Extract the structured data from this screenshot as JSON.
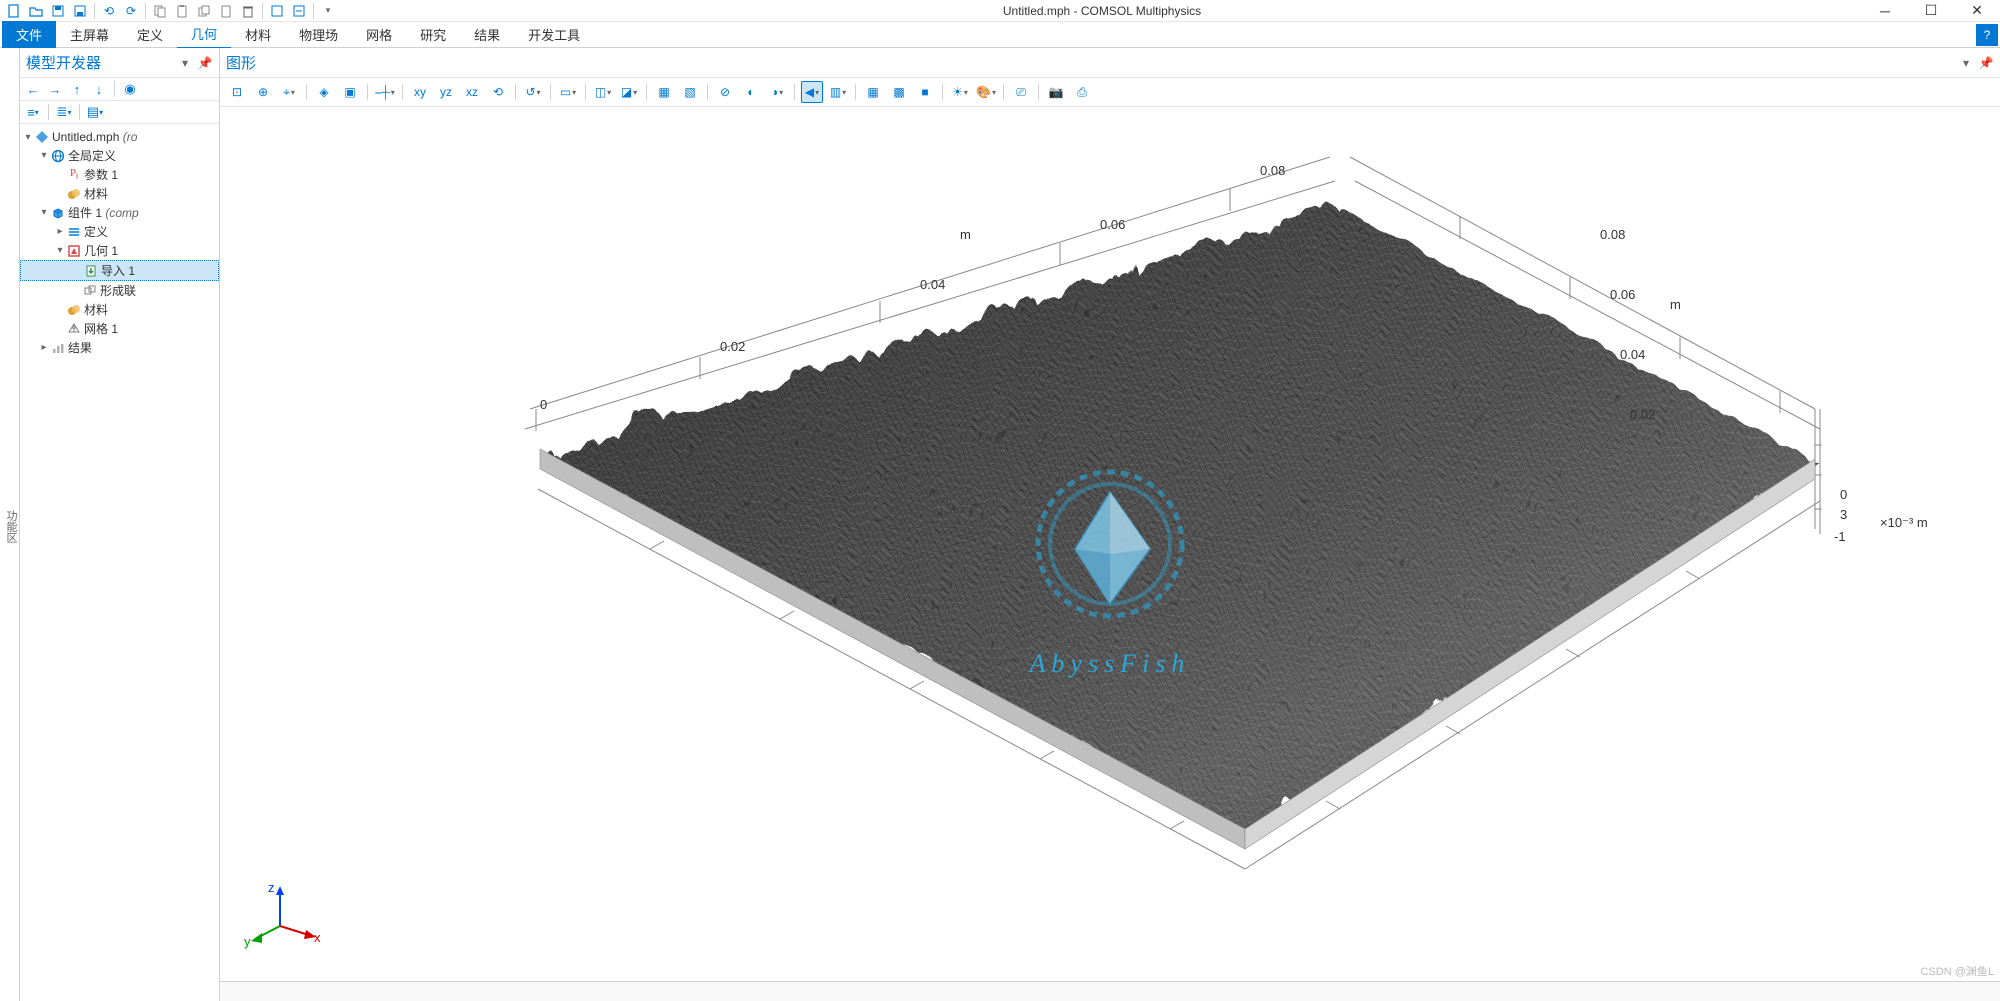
{
  "app_title": "Untitled.mph - COMSOL Multiphysics",
  "qat_icons": [
    "new-file",
    "open-file",
    "save",
    "save-as",
    "separator",
    "undo",
    "redo",
    "separator",
    "copy",
    "paste-special",
    "copy-node",
    "paste",
    "delete",
    "separator",
    "find",
    "find-replace",
    "separator",
    "settings-dropdown"
  ],
  "ribbon": {
    "file": "文件",
    "tabs": [
      "主屏幕",
      "定义",
      "几何",
      "材料",
      "物理场",
      "网格",
      "研究",
      "结果",
      "开发工具"
    ],
    "active": "几何"
  },
  "sidebar_vert": "功能区",
  "model_builder": {
    "title": "模型开发器",
    "head_icons": [
      "pin-icon",
      "dropdown-icon"
    ],
    "nav": [
      "back",
      "forward",
      "up",
      "down",
      "separator",
      "show-more"
    ],
    "view": [
      "collapse",
      "separator",
      "expand",
      "separator",
      "sort"
    ],
    "tree": [
      {
        "depth": 0,
        "exp": "▾",
        "icon": "diamond",
        "color": "#0078d4",
        "label": "Untitled.mph",
        "suffix": "(ro"
      },
      {
        "depth": 1,
        "exp": "▾",
        "icon": "globe",
        "color": "#0078d4",
        "label": "全局定义"
      },
      {
        "depth": 2,
        "exp": "",
        "icon": "pi",
        "color": "#d05050",
        "label": "参数 1"
      },
      {
        "depth": 2,
        "exp": "",
        "icon": "materials",
        "color": "#e0a030",
        "label": "材料"
      },
      {
        "depth": 1,
        "exp": "▾",
        "icon": "cube",
        "color": "#0078d4",
        "label": "组件 1",
        "suffix": "(comp"
      },
      {
        "depth": 2,
        "exp": "▸",
        "icon": "defs",
        "color": "#0078d4",
        "label": "定义"
      },
      {
        "depth": 2,
        "exp": "▾",
        "icon": "geom",
        "color": "#d05050",
        "label": "几何 1"
      },
      {
        "depth": 3,
        "exp": "",
        "icon": "import",
        "color": "#309050",
        "label": "导入 1",
        "sel": true
      },
      {
        "depth": 3,
        "exp": "",
        "icon": "union",
        "color": "#808080",
        "label": "形成联"
      },
      {
        "depth": 2,
        "exp": "",
        "icon": "materials",
        "color": "#e0a030",
        "label": "材料"
      },
      {
        "depth": 2,
        "exp": "",
        "icon": "mesh",
        "color": "#808080",
        "label": "网格 1"
      },
      {
        "depth": 1,
        "exp": "▸",
        "icon": "results",
        "color": "#808080",
        "label": "结果"
      }
    ]
  },
  "graphics": {
    "title": "图形",
    "head_icons": [
      "pin-icon",
      "dropdown-icon"
    ],
    "tools": [
      "zoom-extents",
      "zoom-in",
      "zoom-box",
      "dd",
      "sep",
      "zoom-selected",
      "zoom-window",
      "sep",
      "coord-origin",
      "dd",
      "sep",
      "xy-plane",
      "yz-plane",
      "xz-plane",
      "rotate-view",
      "sep",
      "reset",
      "dd",
      "sep",
      "select-box",
      "dd",
      "sep",
      "select-mode",
      "dd",
      "select-adjacent",
      "dd",
      "sep",
      "sel-create",
      "sel-toggle",
      "sep",
      "hide-sel",
      "hide-others",
      "show-hidden",
      "dd",
      "sep",
      "view-opts-active",
      "dd",
      "view-split",
      "dd",
      "sep",
      "render-mesh",
      "render-wire",
      "render-solid",
      "sep",
      "scene-light",
      "dd",
      "palette",
      "dd",
      "sep",
      "camera",
      "sep",
      "snapshot",
      "print"
    ],
    "axes": {
      "x_label": "m",
      "y_label": "m",
      "z_label": "m",
      "x_ticks": [
        "0",
        "0.02",
        "0.04",
        "0.06",
        "0.08"
      ],
      "y_ticks": [
        "0.02",
        "0.04",
        "0.06",
        "0.08"
      ],
      "z_ticks": [
        "0",
        "3",
        "-1"
      ],
      "z_scale": "×10⁻³"
    },
    "triad": {
      "x": "x",
      "y": "y",
      "z": "z"
    }
  },
  "watermark": "AbyssFish",
  "csdn": "CSDN @渊鱼L"
}
